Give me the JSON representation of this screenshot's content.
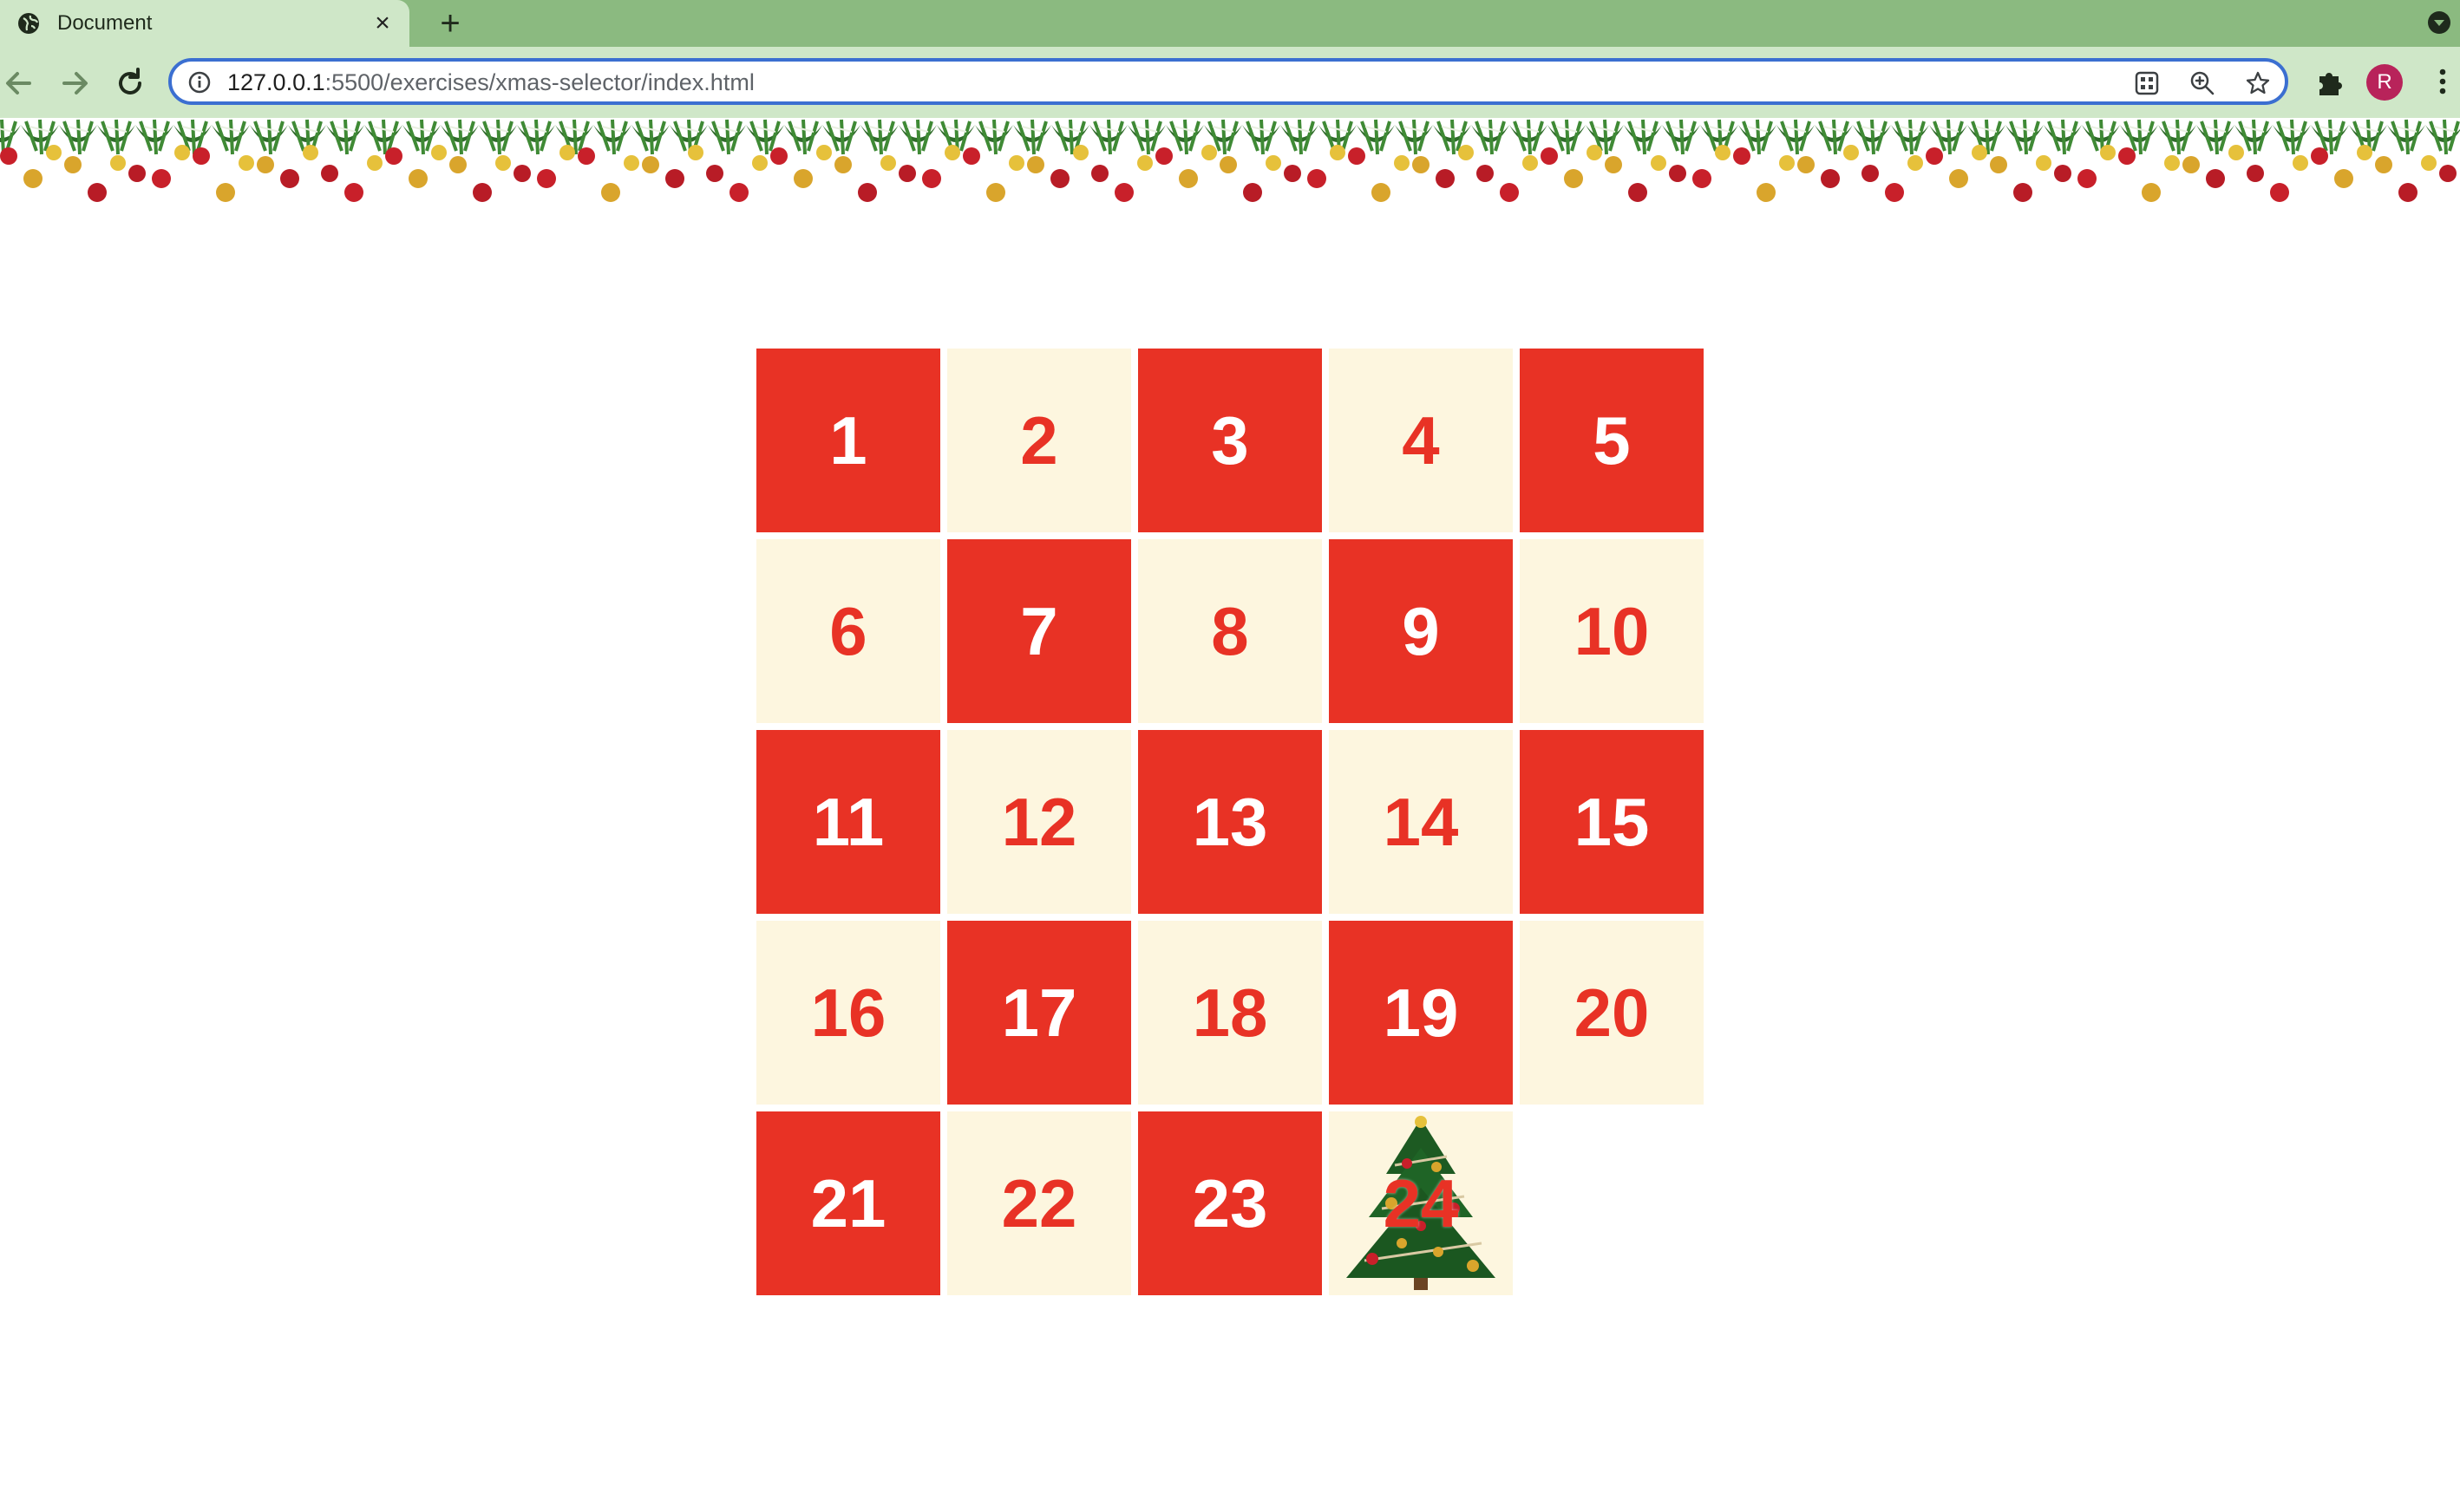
{
  "browser": {
    "tab_title": "Document",
    "close_glyph": "×",
    "new_tab_glyph": "+",
    "url_host": "127.0.0.1",
    "url_rest": ":5500/exercises/xmas-selector/index.html",
    "profile_initial": "R",
    "icons": [
      "globe-icon",
      "close-icon",
      "new-tab-icon",
      "back-icon",
      "forward-icon",
      "reload-icon",
      "info-icon",
      "install-app-icon",
      "zoom-icon",
      "bookmark-star-icon",
      "extensions-icon",
      "menu-icon",
      "tab-search-icon"
    ],
    "colors": {
      "tabbar": "#8bba80",
      "toolbar": "#cfe7c8",
      "omnibox_border": "#3b6fd1",
      "avatar": "#b8235a"
    }
  },
  "calendar": {
    "days": [
      {
        "label": "1",
        "style": "red"
      },
      {
        "label": "2",
        "style": "cream"
      },
      {
        "label": "3",
        "style": "red"
      },
      {
        "label": "4",
        "style": "cream"
      },
      {
        "label": "5",
        "style": "red"
      },
      {
        "label": "6",
        "style": "cream"
      },
      {
        "label": "7",
        "style": "red"
      },
      {
        "label": "8",
        "style": "cream"
      },
      {
        "label": "9",
        "style": "red"
      },
      {
        "label": "10",
        "style": "cream"
      },
      {
        "label": "11",
        "style": "red"
      },
      {
        "label": "12",
        "style": "cream"
      },
      {
        "label": "13",
        "style": "red"
      },
      {
        "label": "14",
        "style": "cream"
      },
      {
        "label": "15",
        "style": "red"
      },
      {
        "label": "16",
        "style": "cream"
      },
      {
        "label": "17",
        "style": "red"
      },
      {
        "label": "18",
        "style": "cream"
      },
      {
        "label": "19",
        "style": "red"
      },
      {
        "label": "20",
        "style": "cream"
      },
      {
        "label": "21",
        "style": "red"
      },
      {
        "label": "22",
        "style": "cream"
      },
      {
        "label": "23",
        "style": "red"
      },
      {
        "label": "24",
        "style": "cream",
        "tree": true
      }
    ],
    "colors": {
      "red": "#e83225",
      "cream": "#fdf6df"
    }
  }
}
